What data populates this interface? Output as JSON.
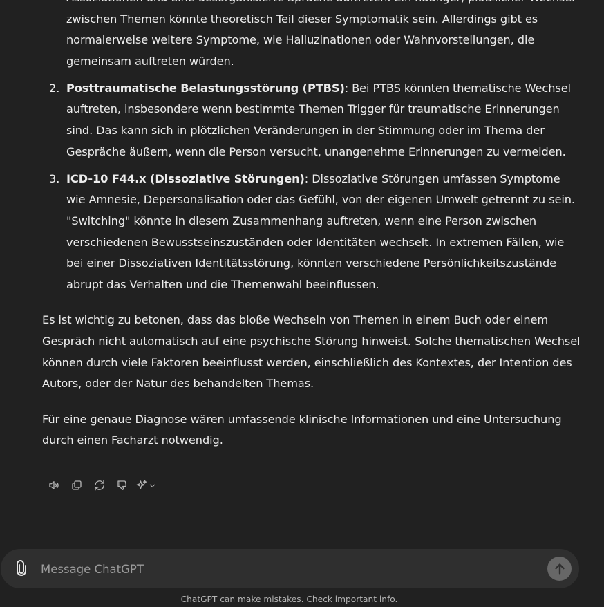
{
  "response": {
    "list_items": [
      {
        "number": "",
        "term": "",
        "text": "Assoziationen und eine desorganisierte Sprache auftreten. Ein häufiger, plötzlicher Wechsel zwischen Themen könnte theoretisch Teil dieser Symptomatik sein. Allerdings gibt es normalerweise weitere Symptome, wie Halluzinationen oder Wahnvorstellungen, die gemeinsam auftreten würden."
      },
      {
        "number": "2.",
        "term": "Posttraumatische Belastungsstörung (PTBS)",
        "text": ": Bei PTBS könnten thematische Wechsel auftreten, insbesondere wenn bestimmte Themen Trigger für traumatische Erinnerungen sind. Das kann sich in plötzlichen Veränderungen in der Stimmung oder im Thema der Gespräche äußern, wenn die Person versucht, unangenehme Erinnerungen zu vermeiden."
      },
      {
        "number": "3.",
        "term": "ICD-10 F44.x (Dissoziative Störungen)",
        "text": ": Dissoziative Störungen umfassen Symptome wie Amnesie, Depersonalisation oder das Gefühl, von der eigenen Umwelt getrennt zu sein. \"Switching\" könnte in diesem Zusammenhang auftreten, wenn eine Person zwischen verschiedenen Bewusstseinszuständen oder Identitäten wechselt. In extremen Fällen, wie bei einer Dissoziativen Identitätsstörung, könnten verschiedene Persönlichkeitszustände abrupt das Verhalten und die Themenwahl beeinflussen."
      }
    ],
    "paragraphs": [
      "Es ist wichtig zu betonen, dass das bloße Wechseln von Themen in einem Buch oder einem Gespräch nicht automatisch auf eine psychische Störung hinweist. Solche thematischen Wechsel können durch viele Faktoren beeinflusst werden, einschließlich des Kontextes, der Intention des Autors, oder der Natur des behandelten Themas.",
      "Für eine genaue Diagnose wären umfassende klinische Informationen und eine Untersuchung durch einen Facharzt notwendig."
    ]
  },
  "actions": {
    "icons": [
      "speaker-icon",
      "copy-icon",
      "regenerate-icon",
      "thumbs-down-icon",
      "sparkle-icon",
      "chevron-down-icon"
    ]
  },
  "composer": {
    "placeholder": "Message ChatGPT",
    "value": "",
    "attach_icon": "paperclip-icon",
    "send_icon": "arrow-up-icon"
  },
  "footer": {
    "disclaimer": "ChatGPT can make mistakes. Check important info."
  },
  "colors": {
    "background": "#212121",
    "composer": "#2f2f2f",
    "text": "#ececec",
    "muted": "#b4b4b4",
    "send_button": "#676767"
  }
}
